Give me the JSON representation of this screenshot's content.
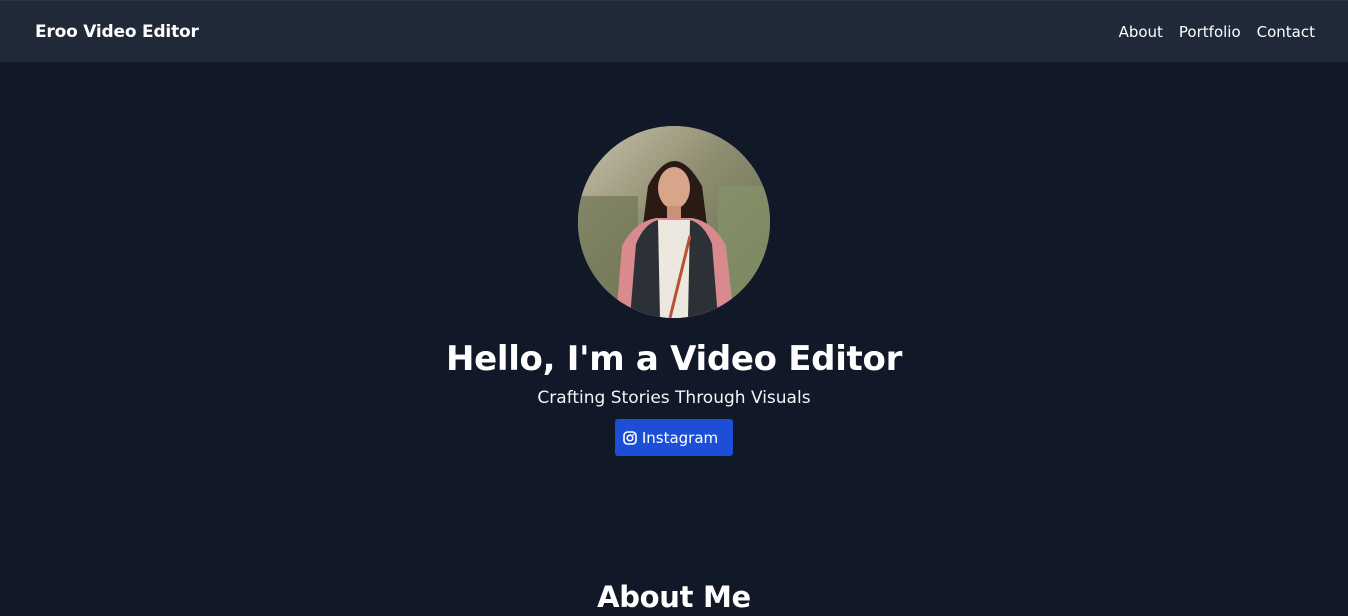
{
  "navbar": {
    "brand": "Eroo Video Editor",
    "links": [
      {
        "label": "About"
      },
      {
        "label": "Portfolio"
      },
      {
        "label": "Contact"
      }
    ]
  },
  "hero": {
    "avatar_icon": "profile-photo",
    "title": "Hello, I'm a Video Editor",
    "subtitle": "Crafting Stories Through Visuals",
    "instagram_button": {
      "icon": "instagram-icon",
      "label": "Instagram"
    }
  },
  "about": {
    "title": "About Me"
  },
  "colors": {
    "page_background": "#111827",
    "navbar_background": "#1f2937",
    "button_background": "#1d4ed8",
    "text": "#ffffff"
  }
}
